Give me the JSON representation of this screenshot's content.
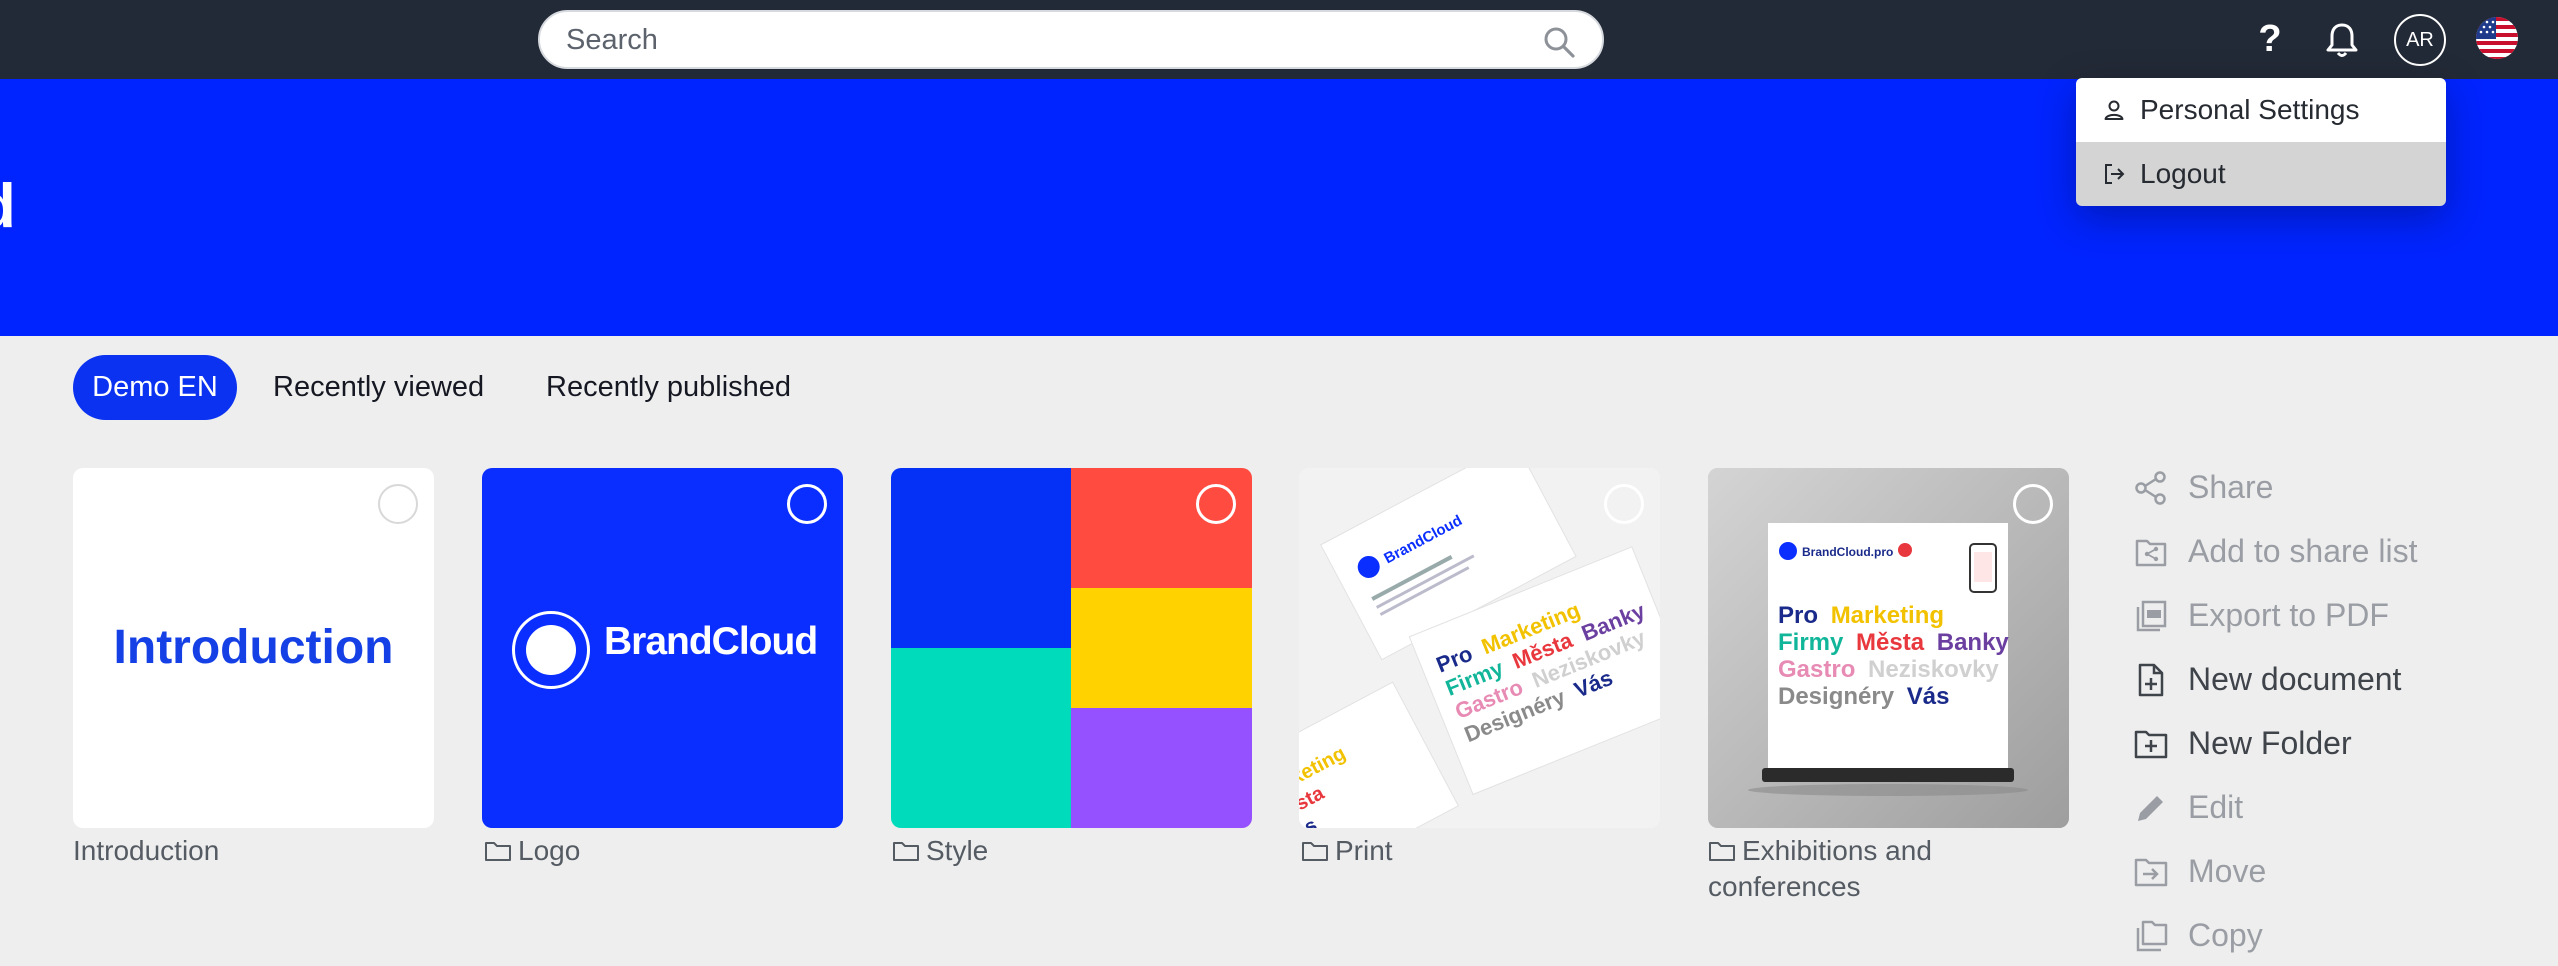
{
  "topbar": {
    "search_placeholder": "Search",
    "help_label": "?",
    "avatar_initials": "AR"
  },
  "banner": {
    "title": "BrandCloud"
  },
  "user_menu": {
    "items": [
      {
        "label": "Personal Settings",
        "icon": "person-icon"
      },
      {
        "label": "Logout",
        "icon": "logout-icon"
      }
    ]
  },
  "tabs": [
    {
      "label": "Demo EN",
      "active": true
    },
    {
      "label": "Recently viewed",
      "active": false
    },
    {
      "label": "Recently published",
      "active": false
    }
  ],
  "cards": [
    {
      "caption": "Introduction",
      "thumb_text": "Introduction",
      "type": "document"
    },
    {
      "caption": "Logo",
      "thumb_text": "BrandCloud",
      "type": "folder"
    },
    {
      "caption": "Style",
      "type": "folder"
    },
    {
      "caption": "Print",
      "type": "folder"
    },
    {
      "caption": "Exhibitions and conferences",
      "type": "folder"
    }
  ],
  "actions": [
    {
      "label": "Share",
      "icon": "share-icon",
      "enabled": false
    },
    {
      "label": "Add to share list",
      "icon": "add-to-share-list-icon",
      "enabled": false
    },
    {
      "label": "Export to PDF",
      "icon": "pdf-icon",
      "enabled": false
    },
    {
      "label": "New document",
      "icon": "new-document-icon",
      "enabled": true
    },
    {
      "label": "New Folder",
      "icon": "new-folder-icon",
      "enabled": true
    },
    {
      "label": "Edit",
      "icon": "pencil-icon",
      "enabled": false
    },
    {
      "label": "Move",
      "icon": "move-folder-icon",
      "enabled": false
    },
    {
      "label": "Copy",
      "icon": "copy-icon",
      "enabled": false
    }
  ],
  "thumb_text": {
    "card_brand": "BrandCloud",
    "card_brand_pro": "BrandCloud.pro",
    "lines": [
      {
        "words": [
          "Pro",
          "Marketing"
        ]
      },
      {
        "words": [
          "Firmy",
          "Města",
          "Banky"
        ]
      },
      {
        "words": [
          "Gastro",
          "Neziskovky"
        ]
      },
      {
        "words": [
          "Designéry",
          "Vás"
        ]
      }
    ]
  },
  "colors": {
    "topbar": "#232a37",
    "brand_blue": "#0024ff",
    "tab_active": "#0a32f0",
    "style_blue": "#0530f5",
    "style_red": "#ff4b40",
    "style_yellow": "#ffd200",
    "style_teal": "#00dcbb",
    "style_purple": "#9550ff"
  }
}
